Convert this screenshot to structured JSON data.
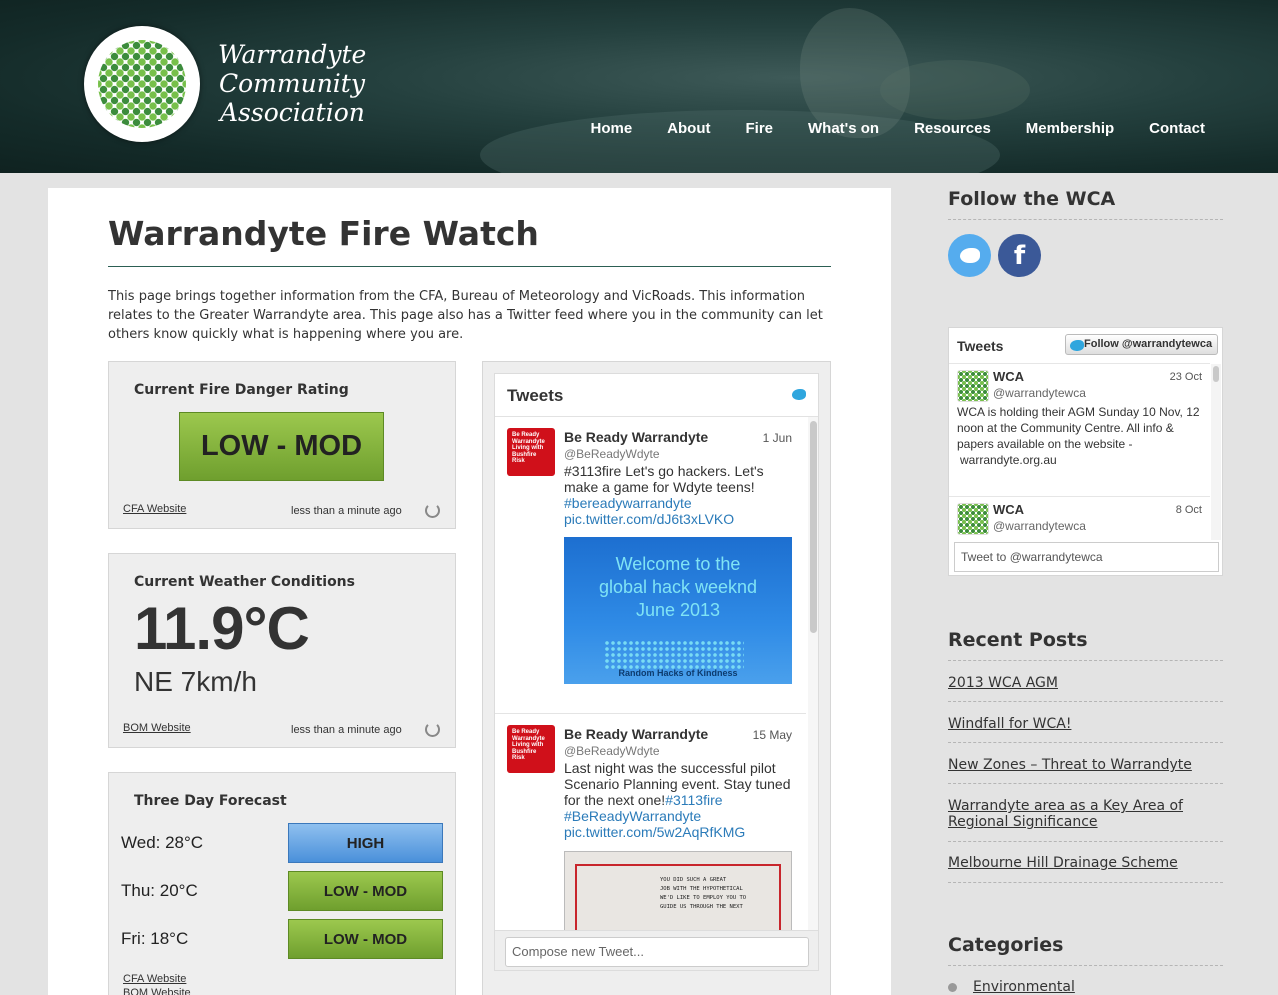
{
  "site": {
    "logo_lines": [
      "Warrandyte",
      "Community",
      "Association"
    ],
    "nav": [
      "Home",
      "About",
      "Fire",
      "What's on",
      "Resources",
      "Membership",
      "Contact"
    ]
  },
  "page": {
    "title": "Warrandyte Fire Watch",
    "intro": "This page brings together information from the CFA, Bureau of Meteorology and VicRoads. This information relates to the Greater Warrandyte area. This page also has a Twitter feed where you in the community can let others know quickly what is happening where you are."
  },
  "fire_danger": {
    "heading": "Current Fire Danger Rating",
    "rating": "LOW - MOD",
    "link": "CFA Website",
    "updated": "less than a minute ago"
  },
  "weather": {
    "heading": "Current Weather Conditions",
    "temperature": "11.9°C",
    "wind": "NE 7km/h",
    "link": "BOM Website",
    "updated": "less than a minute ago"
  },
  "forecast": {
    "heading": "Three Day Forecast",
    "days": [
      {
        "day": "Wed: 28°C",
        "rating": "HIGH"
      },
      {
        "day": "Thu: 20°C",
        "rating": "LOW - MOD"
      },
      {
        "day": "Fri: 18°C",
        "rating": "LOW - MOD"
      }
    ],
    "link1": "CFA Website",
    "link2": "BOM Website"
  },
  "tweets": {
    "title": "Tweets",
    "items": [
      {
        "name": "Be Ready Warrandyte",
        "handle": "@BeReadyWdyte",
        "date": "1 Jun",
        "avatar_text": "Be Ready Warrandyte Living with Bushfire Risk",
        "text": "#3113fire Let's go hackers. Let's make a game for Wdyte teens!",
        "links": [
          "#bereadywarrandyte",
          "pic.twitter.com/dJ6t3xLVKO"
        ],
        "image_lines": [
          "Welcome to the",
          "global hack weeknd",
          "June 2013"
        ],
        "image_caption": "Random Hacks of Kindness"
      },
      {
        "name": "Be Ready Warrandyte",
        "handle": "@BeReadyWdyte",
        "date": "15 May",
        "avatar_text": "Be Ready Warrandyte Living with Bushfire Risk",
        "text": "Last night was the successful pilot Scenario Planning event. Stay tuned for the next one!",
        "text_tag": "#3113fire",
        "links": [
          "#BeReadyWarrandyte",
          "pic.twitter.com/5w2AqRfKMG"
        ],
        "image_lines": [
          "YOU DID SUCH A GREAT",
          "JOB WITH THE HYPOTHETICAL",
          "WE'D LIKE TO EMPLOY YOU TO",
          "GUIDE US THROUGH THE NEXT"
        ]
      }
    ],
    "compose_placeholder": "Compose new Tweet..."
  },
  "sidebar": {
    "follow_heading": "Follow the WCA",
    "social": [
      "twitter-icon",
      "facebook-icon"
    ],
    "widget": {
      "title": "Tweets",
      "follow_button": "Follow @warrandytewca",
      "items": [
        {
          "name": "WCA",
          "handle": "@warrandytewca",
          "date": "23 Oct",
          "text": "WCA is holding their AGM Sunday 10 Nov, 12 noon at the Community Centre. All info & papers available on the website -",
          "link": "warrandyte.org.au"
        },
        {
          "name": "WCA",
          "handle": "@warrandytewca",
          "date": "8 Oct"
        }
      ],
      "compose_placeholder": "Tweet to @warrandytewca"
    },
    "recent_heading": "Recent Posts",
    "recent_posts": [
      "2013 WCA AGM",
      "Windfall for WCA!",
      "New Zones – Threat to Warrandyte",
      "Warrandyte area as a Key Area of Regional Significance",
      "Melbourne Hill Drainage Scheme"
    ],
    "categories_heading": "Categories",
    "categories": [
      "Environmental"
    ]
  },
  "colors": {
    "header_bg": "#1b3533",
    "rating_low_mod": "#8bbb44",
    "rating_high": "#6aa6e4",
    "twitter_blue": "#55acee",
    "facebook_blue": "#3b5998"
  }
}
